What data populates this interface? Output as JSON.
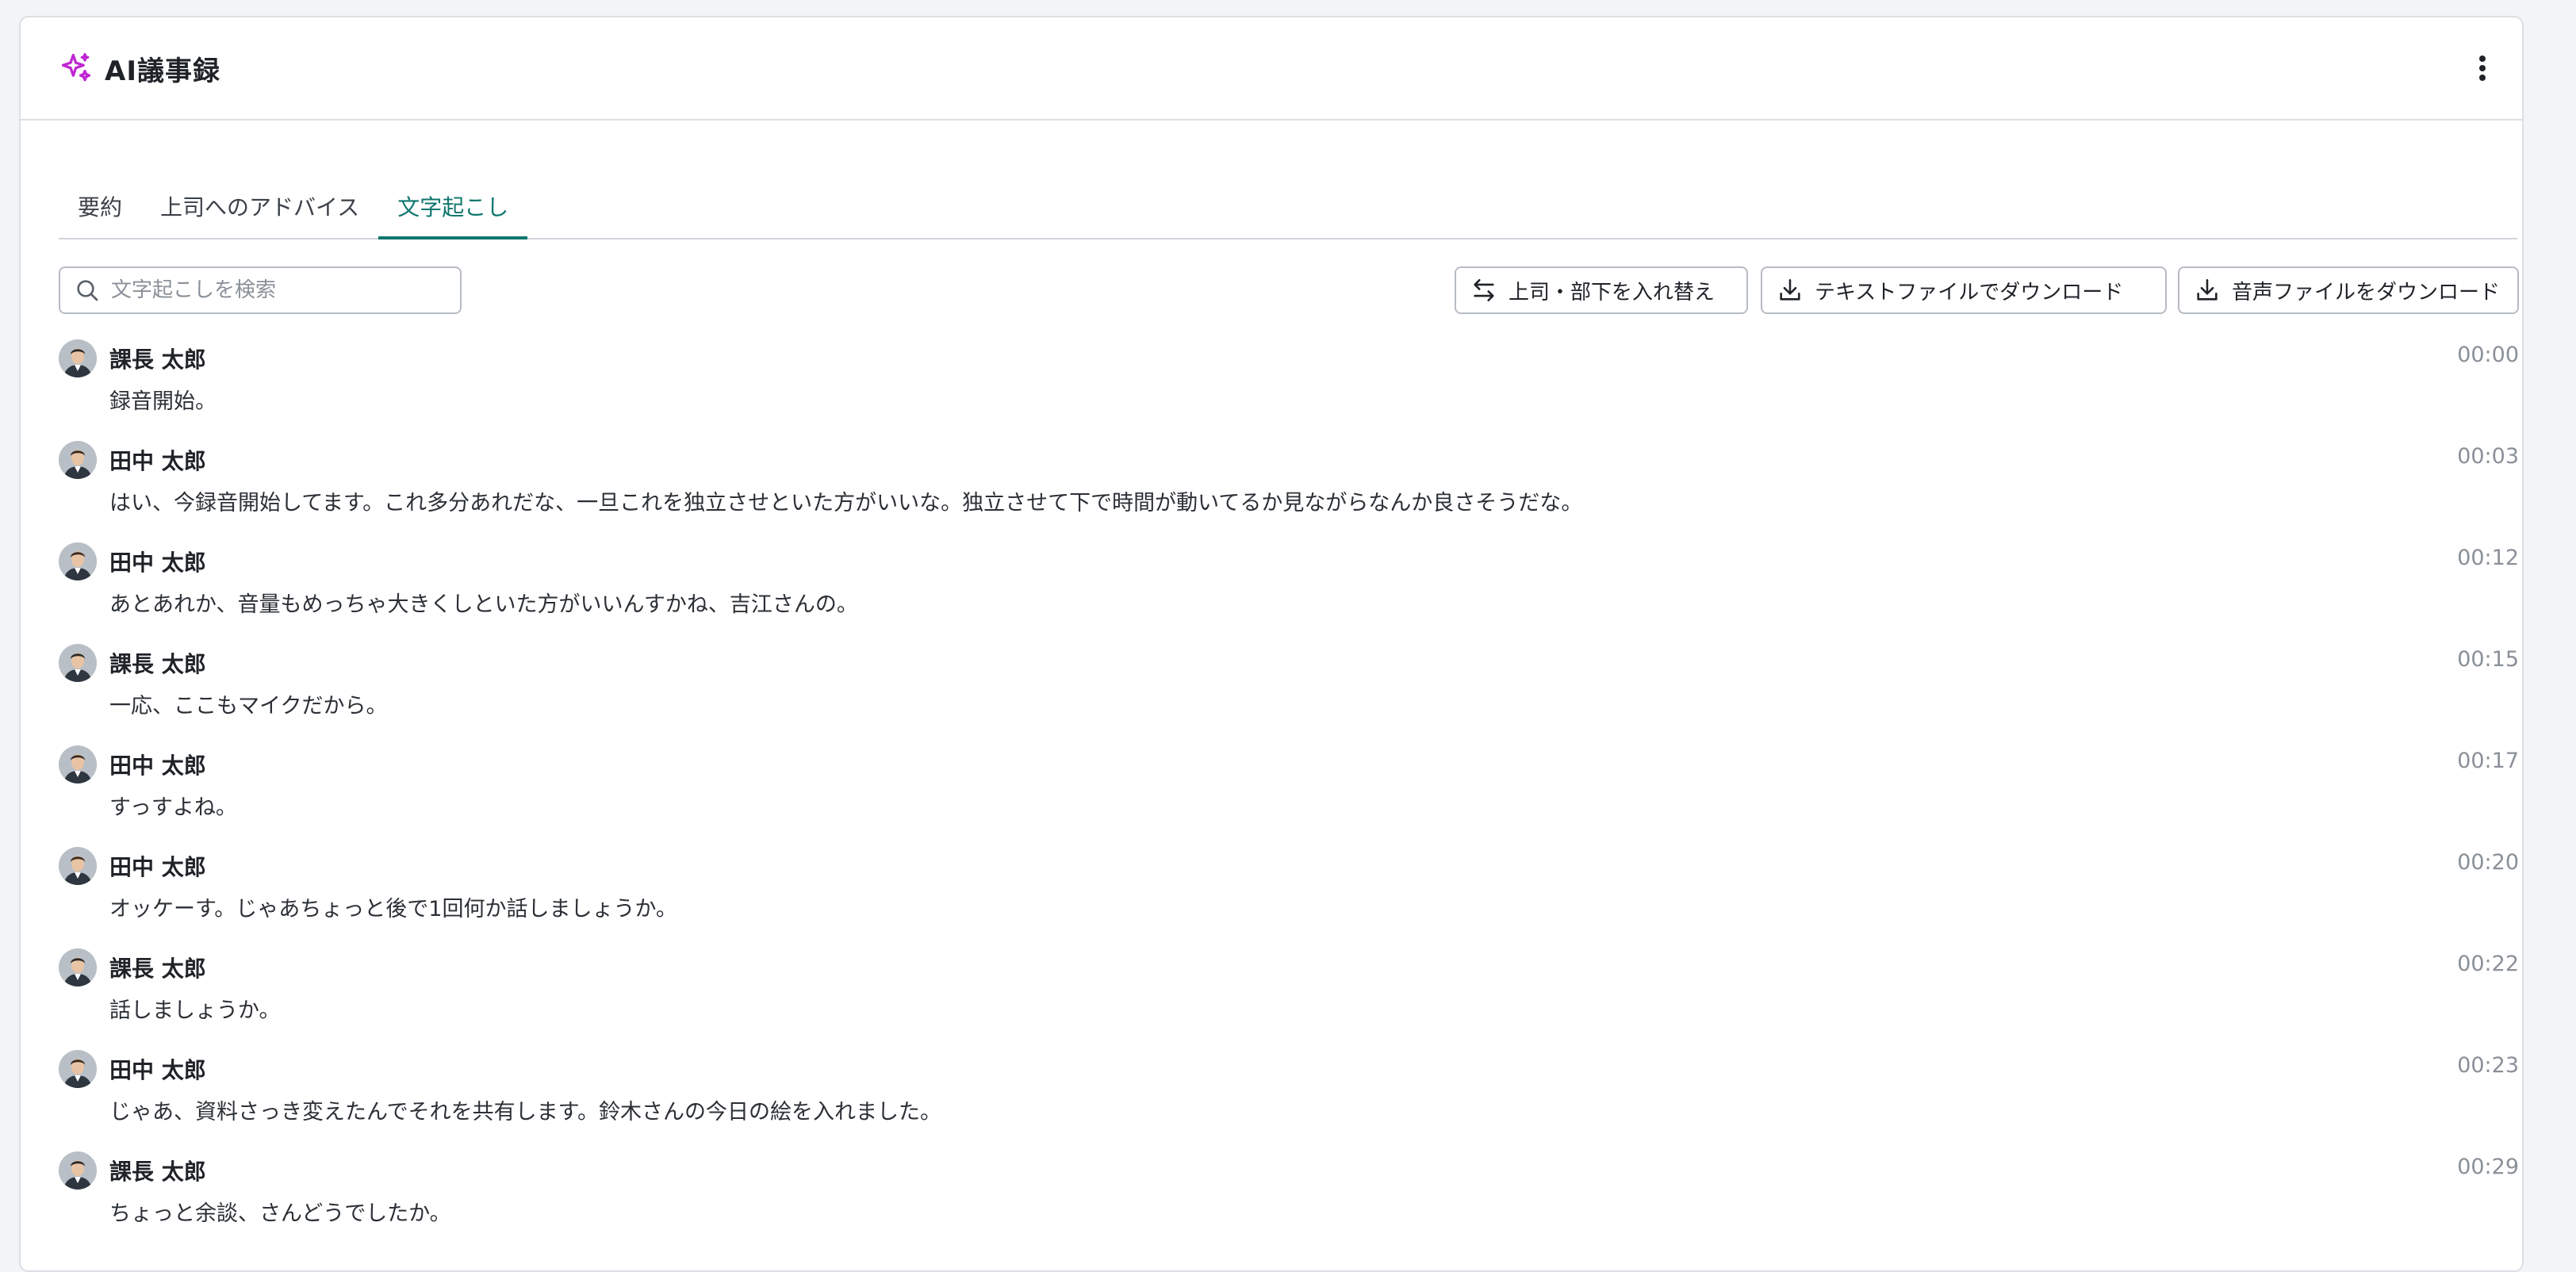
{
  "header": {
    "title": "AI議事録",
    "icon": "sparkles-icon",
    "accent_color": "#c026d3",
    "menu_icon": "more-vertical-icon"
  },
  "tabs": [
    {
      "label": "要約",
      "active": false
    },
    {
      "label": "上司へのアドバイス",
      "active": false
    },
    {
      "label": "文字起こし",
      "active": true
    }
  ],
  "search": {
    "placeholder": "文字起こしを検索",
    "value": ""
  },
  "actions": {
    "swap_label": "上司・部下を入れ替え",
    "download_text_label": "テキストファイルでダウンロード",
    "download_audio_label": "音声ファイルをダウンロード"
  },
  "transcript": [
    {
      "speaker": "課長 太郎",
      "time": "00:00",
      "text": "録音開始。",
      "avatar": "manager"
    },
    {
      "speaker": "田中 太郎",
      "time": "00:03",
      "text": "はい、今録音開始してます。これ多分あれだな、一旦これを独立させといた方がいいな。独立させて下で時間が動いてるか見ながらなんか良さそうだな。",
      "avatar": "staff"
    },
    {
      "speaker": "田中 太郎",
      "time": "00:12",
      "text": "あとあれか、音量もめっちゃ大きくしといた方がいいんすかね、吉江さんの。",
      "avatar": "staff"
    },
    {
      "speaker": "課長 太郎",
      "time": "00:15",
      "text": "一応、ここもマイクだから。",
      "avatar": "manager"
    },
    {
      "speaker": "田中 太郎",
      "time": "00:17",
      "text": "すっすよね。",
      "avatar": "staff"
    },
    {
      "speaker": "田中 太郎",
      "time": "00:20",
      "text": "オッケーす。じゃあちょっと後で1回何か話しましょうか。",
      "avatar": "staff"
    },
    {
      "speaker": "課長 太郎",
      "time": "00:22",
      "text": "話しましょうか。",
      "avatar": "manager"
    },
    {
      "speaker": "田中 太郎",
      "time": "00:23",
      "text": "じゃあ、資料さっき変えたんでそれを共有します。鈴木さんの今日の絵を入れました。",
      "avatar": "staff"
    },
    {
      "speaker": "課長 太郎",
      "time": "00:29",
      "text": "ちょっと余談、さんどうでしたか。",
      "avatar": "manager"
    }
  ]
}
